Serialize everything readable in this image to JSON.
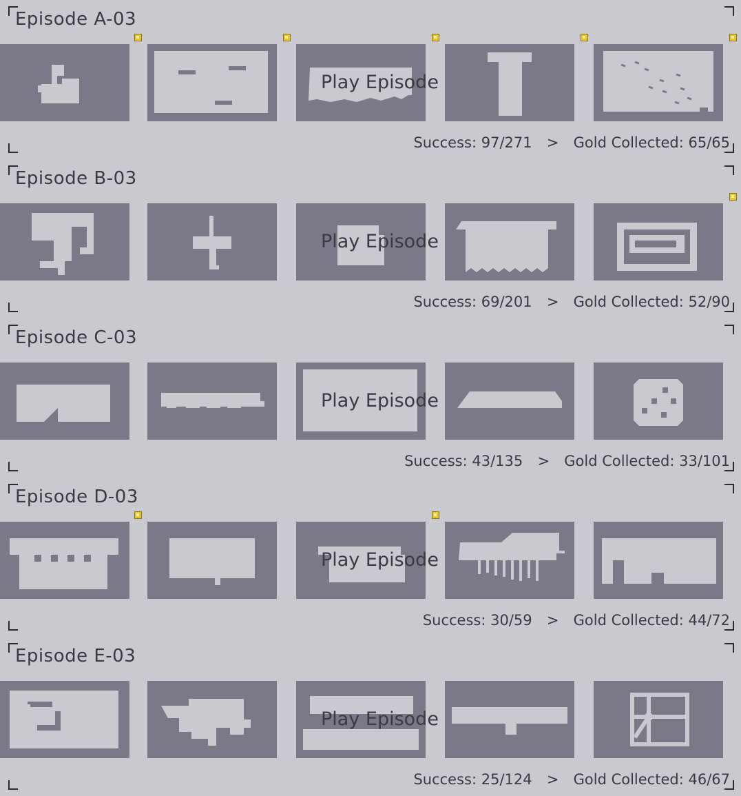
{
  "episodes": [
    {
      "title": "Episode A-03",
      "play_label": "Play Episode",
      "success": "Success: 97/271",
      "separator": ">",
      "gold": "Gold Collected: 65/65",
      "gold_badges": [
        true,
        true,
        true,
        true,
        true
      ]
    },
    {
      "title": "Episode B-03",
      "play_label": "Play Episode",
      "success": "Success: 69/201",
      "separator": ">",
      "gold": "Gold Collected: 52/90",
      "gold_badges": [
        false,
        false,
        false,
        false,
        true
      ]
    },
    {
      "title": "Episode C-03",
      "play_label": "Play Episode",
      "success": "Success: 43/135",
      "separator": ">",
      "gold": "Gold Collected: 33/101",
      "gold_badges": [
        false,
        false,
        false,
        false,
        false
      ]
    },
    {
      "title": "Episode D-03",
      "play_label": "Play Episode",
      "success": "Success: 30/59",
      "separator": ">",
      "gold": "Gold Collected: 44/72",
      "gold_badges": [
        true,
        false,
        true,
        false,
        false
      ]
    },
    {
      "title": "Episode E-03",
      "play_label": "Play Episode",
      "success": "Success: 25/124",
      "separator": ">",
      "gold": "Gold Collected: 46/67",
      "gold_badges": [
        false,
        false,
        false,
        false,
        false
      ]
    }
  ],
  "colors": {
    "background": "#cac9cf",
    "tile": "#7a7987",
    "text": "#3a3a44",
    "gold": "#e8c52c"
  }
}
